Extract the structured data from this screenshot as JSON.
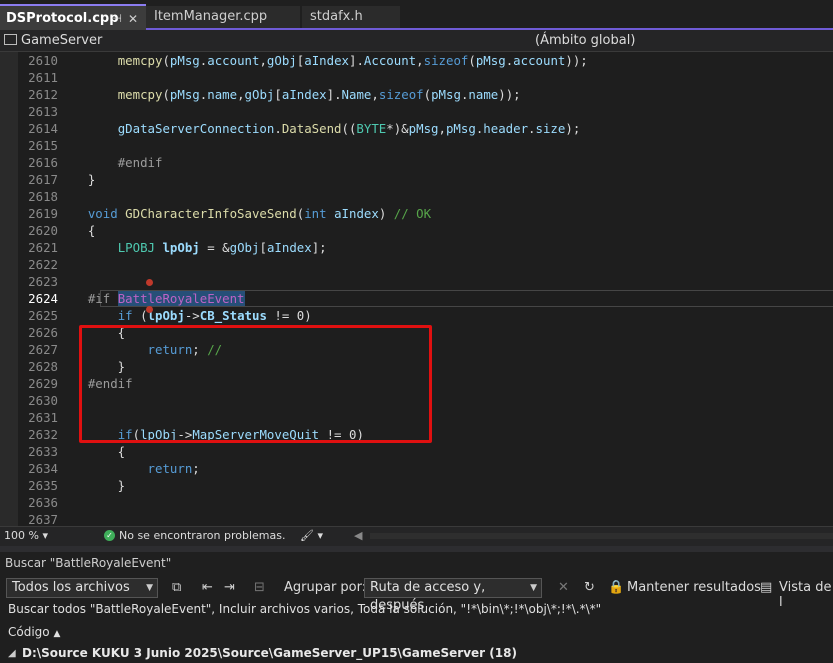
{
  "tabs": [
    {
      "label": "DSProtocol.cpp",
      "pin_icon": "⊣",
      "close_icon": "✕"
    },
    {
      "label": "ItemManager.cpp"
    },
    {
      "label": "stdafx.h"
    }
  ],
  "nav": {
    "project": "GameServer",
    "scope": "(Ámbito global)"
  },
  "code_lines": [
    {
      "num": "2610",
      "html": "        <span class=\"fn\">memcpy</span>(<span class=\"var\">pMsg</span>.<span class=\"var\">account</span>,<span class=\"var\">gObj</span>[<span class=\"var\">aIndex</span>].<span class=\"var\">Account</span>,<span class=\"kw\">sizeof</span>(<span class=\"var\">pMsg</span>.<span class=\"var\">account</span>));"
    },
    {
      "num": "2611",
      "html": ""
    },
    {
      "num": "2612",
      "html": "        <span class=\"fn\">memcpy</span>(<span class=\"var\">pMsg</span>.<span class=\"var\">name</span>,<span class=\"var\">gObj</span>[<span class=\"var\">aIndex</span>].<span class=\"var\">Name</span>,<span class=\"kw\">sizeof</span>(<span class=\"var\">pMsg</span>.<span class=\"var\">name</span>));"
    },
    {
      "num": "2613",
      "html": ""
    },
    {
      "num": "2614",
      "html": "        <span class=\"var\">gDataServerConnection</span>.<span class=\"fn\">DataSend</span>((<span class=\"ty\">BYTE</span>*)&amp;<span class=\"var\">pMsg</span>,<span class=\"var\">pMsg</span>.<span class=\"var\">header</span>.<span class=\"var\">size</span>);"
    },
    {
      "num": "2615",
      "html": ""
    },
    {
      "num": "2616",
      "html": "        <span class=\"pp\">#endif</span>"
    },
    {
      "num": "2617",
      "html": "    }"
    },
    {
      "num": "2618",
      "html": ""
    },
    {
      "num": "2619",
      "html": "    <span class=\"kw\">void</span> <span class=\"fn\">GDCharacterInfoSaveSend</span>(<span class=\"kw\">int</span> <span class=\"var\">aIndex</span>) <span class=\"cm\">// OK</span>"
    },
    {
      "num": "2620",
      "html": "    {"
    },
    {
      "num": "2621",
      "html": "        <span class=\"ty\">LPOBJ</span> <b class=\"var\">lpObj</b> = &amp;<span class=\"var\">gObj</span>[<span class=\"var\">aIndex</span>];"
    },
    {
      "num": "2622",
      "html": ""
    },
    {
      "num": "2623",
      "html": ""
    },
    {
      "num": "2624",
      "html": "    <span class=\"pp\">#if</span> <span class=\"mac sel\">BattleRoyaleEvent</span>",
      "current": true
    },
    {
      "num": "2625",
      "html": "        <span class=\"kw\">if</span> (<b class=\"var\">lpObj</b>-&gt;<b class=\"var\">CB_Status</b> != <span class=\"num\">0</span>)"
    },
    {
      "num": "2626",
      "html": "        {"
    },
    {
      "num": "2627",
      "html": "            <span class=\"kw\">return</span>; <span class=\"cm\">//</span>"
    },
    {
      "num": "2628",
      "html": "        }"
    },
    {
      "num": "2629",
      "html": "    <span class=\"pp\">#endif</span>"
    },
    {
      "num": "2630",
      "html": ""
    },
    {
      "num": "2631",
      "html": ""
    },
    {
      "num": "2632",
      "html": "        <span class=\"kw\">if</span>(<span class=\"var\">lpObj</span>-&gt;<span class=\"var\">MapServerMoveQuit</span> != <span class=\"num\">0</span>)"
    },
    {
      "num": "2633",
      "html": "        {"
    },
    {
      "num": "2634",
      "html": "            <span class=\"kw\">return</span>;"
    },
    {
      "num": "2635",
      "html": "        }"
    },
    {
      "num": "2636",
      "html": ""
    },
    {
      "num": "2637",
      "html": ""
    }
  ],
  "status": {
    "zoom": "100 %",
    "message": "No se encontraron problemas.",
    "check_icon": "✓"
  },
  "find": {
    "title": "Buscar \"BattleRoyaleEvent\"",
    "scope_value": "Todos los archivos",
    "group_label": "Agrupar por:",
    "group_value": "Ruta de acceso y, después",
    "keep_results": "Mantener resultados",
    "view_label": "Vista de l",
    "description": "Buscar todos \"BattleRoyaleEvent\", Incluir archivos varios, Toda la solución, \"!*\\bin\\*;!*\\obj\\*;!*\\.*\\*\"",
    "code_label": "Código",
    "result_path": "D:\\Source KUKU 3 Junio 2025\\Source\\GameServer_UP15\\GameServer (18)"
  },
  "colors": {
    "accent": "#6f5bd6",
    "highlight_box": "#e01010",
    "ok_green": "#3fae5a"
  }
}
